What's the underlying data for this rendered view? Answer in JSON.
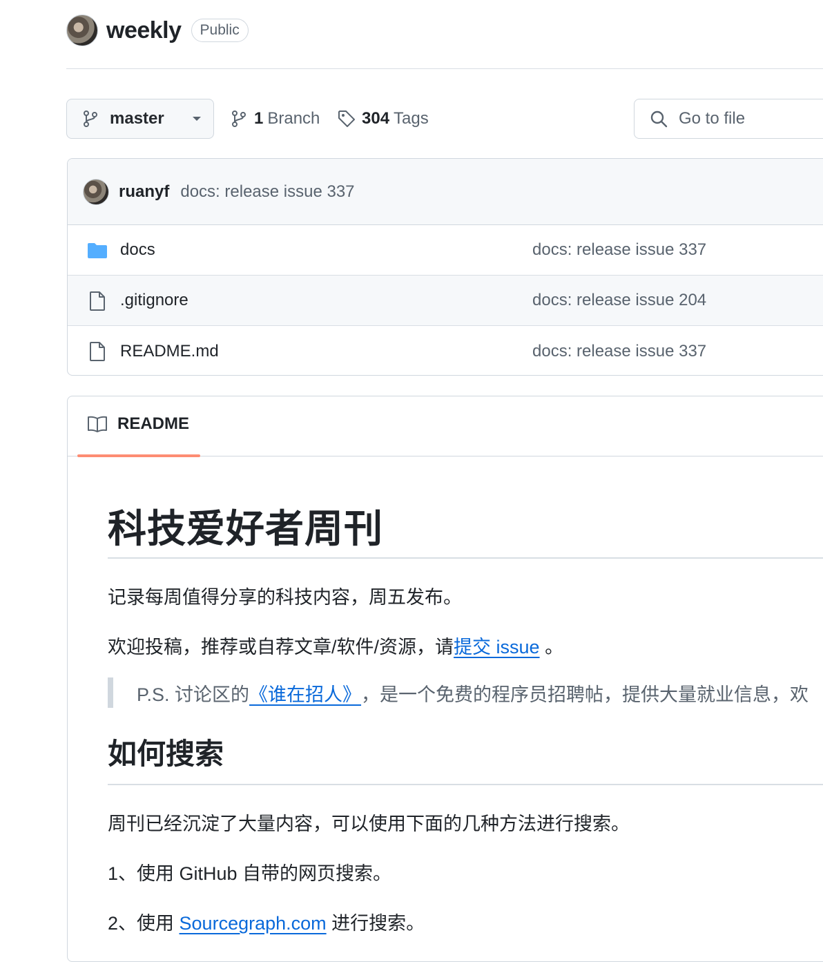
{
  "repo": {
    "name": "weekly",
    "visibility": "Public"
  },
  "toolbar": {
    "branch": "master",
    "branch_count": "1",
    "branch_label": "Branch",
    "tag_count": "304",
    "tag_label": "Tags",
    "goto_placeholder": "Go to file"
  },
  "latest_commit": {
    "author": "ruanyf",
    "message": "docs: release issue 337"
  },
  "files": [
    {
      "name": "docs",
      "type": "folder",
      "commit": "docs: release issue 337"
    },
    {
      "name": ".gitignore",
      "type": "file",
      "commit": "docs: release issue 204"
    },
    {
      "name": "README.md",
      "type": "file",
      "commit": "docs: release issue 337"
    }
  ],
  "readme": {
    "tab_label": "README",
    "title": "科技爱好者周刊",
    "intro": "记录每周值得分享的科技内容，周五发布。",
    "contribute_prefix": "欢迎投稿，推荐或自荐文章/软件/资源，请",
    "contribute_link": "提交 issue",
    "contribute_suffix": " 。",
    "quote_prefix": "P.S. 讨论区的",
    "quote_link": "《谁在招人》",
    "quote_suffix": "，是一个免费的程序员招聘帖，提供大量就业信息，欢",
    "search_heading": "如何搜索",
    "search_intro": "周刊已经沉淀了大量内容，可以使用下面的几种方法进行搜索。",
    "method1": "1、使用 GitHub 自带的网页搜索。",
    "method2_prefix": "2、使用 ",
    "method2_link": "Sourcegraph.com",
    "method2_suffix": " 进行搜索。"
  },
  "colors": {
    "link": "#0969da",
    "folder": "#54aeff",
    "tab_underline": "#fd8c73"
  }
}
